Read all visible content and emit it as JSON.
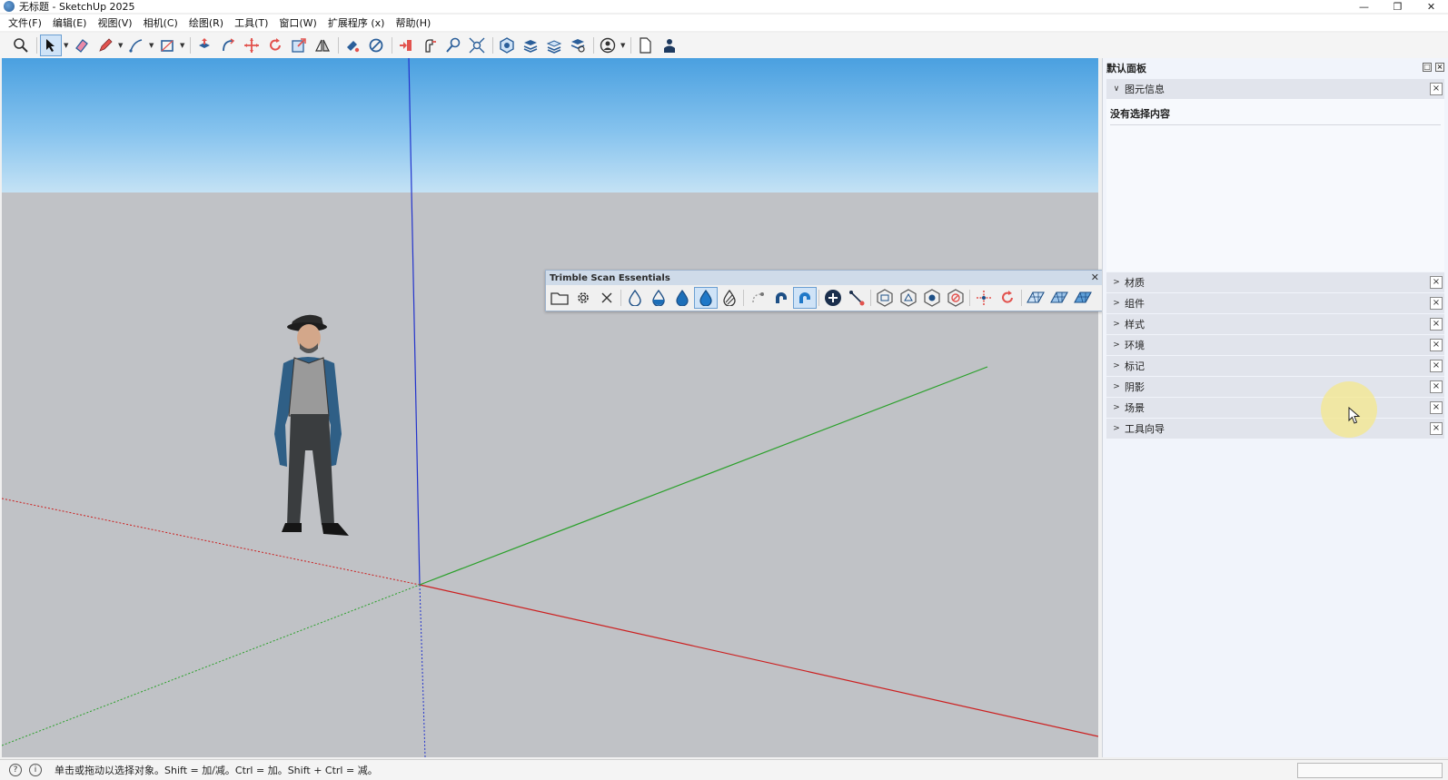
{
  "window": {
    "title": "无标题 - SketchUp 2025",
    "controls": [
      "minimize",
      "restore",
      "close"
    ]
  },
  "menu": [
    "文件(F)",
    "编辑(E)",
    "视图(V)",
    "相机(C)",
    "绘图(R)",
    "工具(T)",
    "窗口(W)",
    "扩展程序 (x)",
    "帮助(H)"
  ],
  "toolbar": {
    "tools": [
      "search-icon",
      "select-icon",
      "eraser-icon",
      "pencil-icon",
      "line-icon",
      "rectangle-icon",
      "push-pull-icon",
      "follow-me-icon",
      "move-icon",
      "rotate-icon",
      "scale-icon",
      "flip-icon",
      "paint-icon",
      "sample-icon",
      "section-icon",
      "tape-icon",
      "magnify-icon",
      "zoom-extents-icon",
      "components-icon",
      "layers-icon",
      "materials-icon",
      "scenes-icon",
      "account-icon",
      "page-icon",
      "profile-icon"
    ],
    "active_tool": "select-icon"
  },
  "scan_toolbar": {
    "title": "Trimble Scan Essentials",
    "buttons": [
      "folder-icon",
      "settings-icon",
      "close-x-icon",
      "drop-outline-icon",
      "drop-half-icon",
      "drop-full-icon",
      "drop-active-icon",
      "drop-striped-icon",
      "snap-off-icon",
      "magnet-icon",
      "magnet-active-icon",
      "add-point-icon",
      "line-snap-icon",
      "cube-a-icon",
      "cube-b-icon",
      "cube-c-icon",
      "cube-d-icon",
      "axes-icon",
      "rotate-icon",
      "mesh-a-icon",
      "mesh-b-icon",
      "mesh-c-icon"
    ]
  },
  "tray": {
    "title": "默认面板",
    "entity_info": {
      "label": "图元信息",
      "content": "没有选择内容"
    },
    "sections": [
      "材质",
      "组件",
      "样式",
      "环境",
      "标记",
      "阴影",
      "场景",
      "工具向导"
    ]
  },
  "status": {
    "message": "单击或拖动以选择对象。Shift = 加/减。Ctrl = 加。Shift + Ctrl = 减。"
  },
  "colors": {
    "sky_top": "#4aa0e0",
    "ground": "#c0c2c6",
    "axis_red": "#cc1f1f",
    "axis_green": "#2aa02a",
    "axis_blue": "#2233cc",
    "tray_bg": "#f1f4fb"
  }
}
